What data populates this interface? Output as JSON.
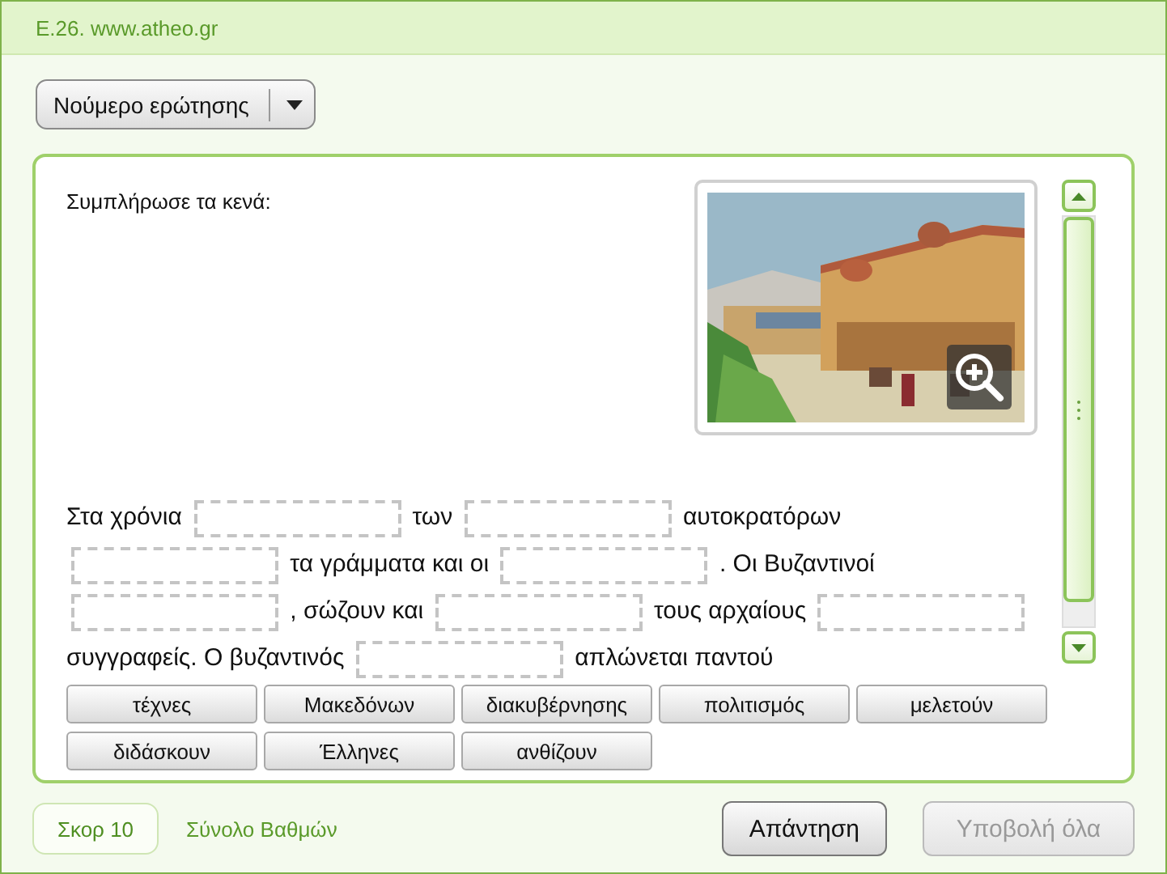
{
  "header": {
    "title": "E.26. www.atheo.gr"
  },
  "question_dropdown": {
    "label": "Νούμερο ερώτησης"
  },
  "instruction": "Συμπλήρωσε τα κενά:",
  "passage": [
    {
      "kind": "text",
      "text": "Στα χρόνια"
    },
    {
      "kind": "blank"
    },
    {
      "kind": "text",
      "text": "των"
    },
    {
      "kind": "blank"
    },
    {
      "kind": "text",
      "text": "αυτοκρατόρων"
    },
    {
      "kind": "blank"
    },
    {
      "kind": "text",
      "text": "τα γράμματα και οι"
    },
    {
      "kind": "blank"
    },
    {
      "kind": "text",
      "text": ". Οι Βυζαντινοί"
    },
    {
      "kind": "blank"
    },
    {
      "kind": "text",
      "text": ", σώζουν και"
    },
    {
      "kind": "blank"
    },
    {
      "kind": "text",
      "text": "τους αρχαίους"
    },
    {
      "kind": "blank"
    },
    {
      "kind": "text",
      "text": "συγγραφείς. Ο βυζαντινός"
    },
    {
      "kind": "blank"
    },
    {
      "kind": "text",
      "text": "απλώνεται παντού"
    }
  ],
  "words": [
    "τέχνες",
    "Μακεδόνων",
    "διακυβέρνησης",
    "πολιτισμός",
    "μελετούν",
    "διδάσκουν",
    "Έλληνες",
    "ανθίζουν"
  ],
  "footer": {
    "score": "Σκορ 10",
    "total_label": "Σύνολο Βαθμών",
    "buttons": [
      {
        "label": "Απάντηση",
        "disabled": false
      },
      {
        "label": "Υποβολή όλα",
        "disabled": true
      }
    ]
  }
}
